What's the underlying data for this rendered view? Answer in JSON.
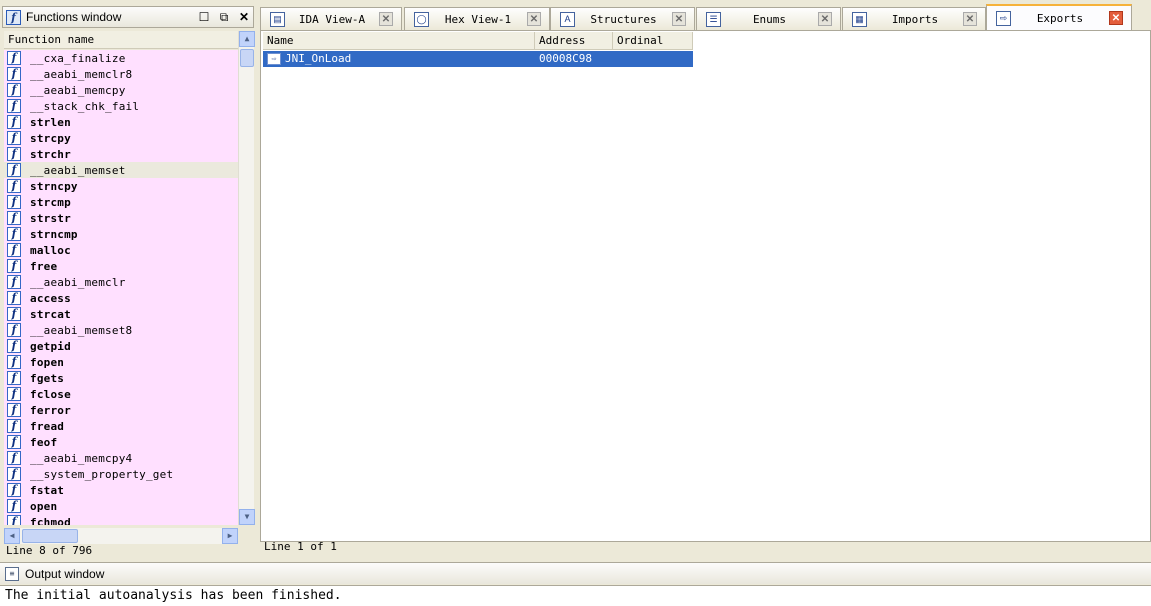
{
  "functions_window": {
    "title": "Functions window",
    "header": "Function name",
    "status": "Line 8 of 796",
    "functions": [
      {
        "name": "__cxa_finalize",
        "bold": false
      },
      {
        "name": "__aeabi_memclr8",
        "bold": false
      },
      {
        "name": "__aeabi_memcpy",
        "bold": false
      },
      {
        "name": "__stack_chk_fail",
        "bold": false
      },
      {
        "name": "strlen",
        "bold": true
      },
      {
        "name": "strcpy",
        "bold": true
      },
      {
        "name": "strchr",
        "bold": true
      },
      {
        "name": "__aeabi_memset",
        "bold": false,
        "selected": true
      },
      {
        "name": "strncpy",
        "bold": true
      },
      {
        "name": "strcmp",
        "bold": true
      },
      {
        "name": "strstr",
        "bold": true
      },
      {
        "name": "strncmp",
        "bold": true
      },
      {
        "name": "malloc",
        "bold": true
      },
      {
        "name": "free",
        "bold": true
      },
      {
        "name": "__aeabi_memclr",
        "bold": false
      },
      {
        "name": "access",
        "bold": true
      },
      {
        "name": "strcat",
        "bold": true
      },
      {
        "name": "__aeabi_memset8",
        "bold": false
      },
      {
        "name": "getpid",
        "bold": true
      },
      {
        "name": "fopen",
        "bold": true
      },
      {
        "name": "fgets",
        "bold": true
      },
      {
        "name": "fclose",
        "bold": true
      },
      {
        "name": "ferror",
        "bold": true
      },
      {
        "name": "fread",
        "bold": true
      },
      {
        "name": "feof",
        "bold": true
      },
      {
        "name": "__aeabi_memcpy4",
        "bold": false
      },
      {
        "name": "__system_property_get",
        "bold": false
      },
      {
        "name": "fstat",
        "bold": true
      },
      {
        "name": "open",
        "bold": true
      },
      {
        "name": "fchmod",
        "bold": true
      }
    ]
  },
  "tabs": [
    {
      "label": "IDA View-A",
      "icon": "ida-view-icon",
      "glyph": "▤",
      "active": false
    },
    {
      "label": "Hex View-1",
      "icon": "hex-view-icon",
      "glyph": "◯",
      "active": false
    },
    {
      "label": "Structures",
      "icon": "structures-icon",
      "glyph": "A",
      "active": false
    },
    {
      "label": "Enums",
      "icon": "enums-icon",
      "glyph": "☰",
      "active": false
    },
    {
      "label": "Imports",
      "icon": "imports-icon",
      "glyph": "▦",
      "active": false
    },
    {
      "label": "Exports",
      "icon": "exports-icon",
      "glyph": "⇨",
      "active": true
    }
  ],
  "exports": {
    "columns": {
      "name": "Name",
      "address": "Address",
      "ordinal": "Ordinal"
    },
    "rows": [
      {
        "name": "JNI_OnLoad",
        "address": "00008C98",
        "ordinal": ""
      }
    ],
    "status": "Line 1 of 1"
  },
  "output_window": {
    "title": "Output window",
    "text": "The initial autoanalysis has been finished."
  },
  "colors": {
    "function_list_bg": "#ffe0ff",
    "selection_bg": "#316ac5",
    "active_tab_accent": "#f6b23a",
    "tab_close_active": "#e35d3c"
  }
}
